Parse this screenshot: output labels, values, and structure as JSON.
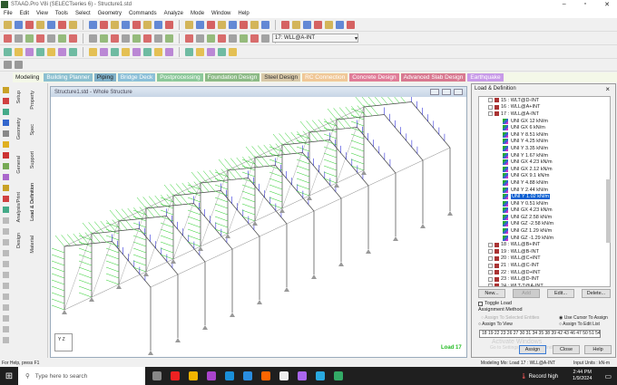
{
  "window": {
    "title": "STAAD.Pro V8i (SELECTseries 6) - Structure1.std"
  },
  "menu": [
    "File",
    "Edit",
    "View",
    "Tools",
    "Select",
    "Geometry",
    "Commands",
    "Analyze",
    "Mode",
    "Window",
    "Help"
  ],
  "toolbar": {
    "load_combo": "17: WLL@A-INT"
  },
  "tabs": [
    {
      "label": "Modeling",
      "color": "#f4f8e8",
      "text": "#222"
    },
    {
      "label": "Building Planner",
      "color": "#8cc0d0"
    },
    {
      "label": "Piping",
      "color": "#7fb0c8",
      "text": "#222"
    },
    {
      "label": "Bridge Deck",
      "color": "#8cc0d8"
    },
    {
      "label": "Postprocessing",
      "color": "#8cc89a"
    },
    {
      "label": "Foundation Design",
      "color": "#8cba86"
    },
    {
      "label": "Steel Design",
      "color": "#d8c8a8",
      "text": "#333"
    },
    {
      "label": "RC Connection",
      "color": "#f0c898"
    },
    {
      "label": "Concrete Design",
      "color": "#e07c98"
    },
    {
      "label": "Advanced Slab Design",
      "color": "#d87890"
    },
    {
      "label": "Earthquake",
      "color": "#c89ae8"
    }
  ],
  "sidebar": {
    "outer_tabs": [
      "Setup",
      "Geometry",
      "General",
      "Analysis/Print",
      "Design"
    ],
    "inner_tabs": [
      "Property",
      "Spec",
      "Support",
      "Load & Definition",
      "Material"
    ]
  },
  "viewport": {
    "title": "Structure1.std - Whole Structure",
    "load_label": "Load 17",
    "axis": "Y  Z"
  },
  "panel": {
    "title": "Load & Definition",
    "close": "×",
    "cases": [
      {
        "id": "15",
        "name": "15 : WLT@D-INT"
      },
      {
        "id": "16",
        "name": "16 : WLL@A+INT"
      },
      {
        "id": "17",
        "name": "17 : WLL@A-INT"
      }
    ],
    "loads": [
      "UNI GX 12 kN/m",
      "UNI GX 6 kN/m",
      "UNI Y 8.51 kN/m",
      "UNI Y 4.25 kN/m",
      "UNI Y 3.35 kN/m",
      "UNI Y 1.67 kN/m",
      "UNI GX 4.23 kN/m",
      "UNI GX 2.12 kN/m",
      "UNI GX 9.1 kN/m",
      "UNI Y 4.88 kN/m",
      "UNI Y 2.44 kN/m",
      "UNI Y 1.02 kN/m",
      "UNI Y 0.51 kN/m",
      "UNI GX 4.23 kN/m",
      "UNI GZ 2.58 kN/m",
      "UNI GZ -2.58 kN/m",
      "UNI GZ 1.29 kN/m",
      "UNI GZ -1.29 kN/m"
    ],
    "selected_load_index": 11,
    "more_cases": [
      "18 : WLL@B+INT",
      "19 : WLL@B-INT",
      "20 : WLL@C+INT",
      "21 : WLL@C-INT",
      "22 : WLL@D+INT",
      "23 : WLL@D-INT",
      "24 : WLT-T@A-INT"
    ],
    "buttons": {
      "new": "New...",
      "add": "Add",
      "edit": "Edit...",
      "delete": "Delete..."
    },
    "toggle_load": "Toggle Load",
    "assignment_method": "Assignment Method",
    "radios": {
      "selected": "Assign To Selected Entities",
      "cursor": "Use Cursor To Assign",
      "view": "Assign To View",
      "edit_list": "Assign To Edit List"
    },
    "edit_list_value": "18 19 22 23 26 27 30 31 34 35 38 39 42 43 46 47 50 51 54",
    "watermark1": "Activate Windows",
    "watermark2": "Go to Settings to activate Windows.",
    "bottom_buttons": {
      "assign": "Assign",
      "close": "Close",
      "help": "Help"
    }
  },
  "status": {
    "help": "For Help, press F1",
    "mode": "Modeling Mo: Load 17 : WLL@A-INT",
    "units": "Input Units : kN-m"
  },
  "taskbar": {
    "search": "Type here to search",
    "weather": "Record high",
    "time": "2:44 PM",
    "date": "1/9/2024"
  }
}
